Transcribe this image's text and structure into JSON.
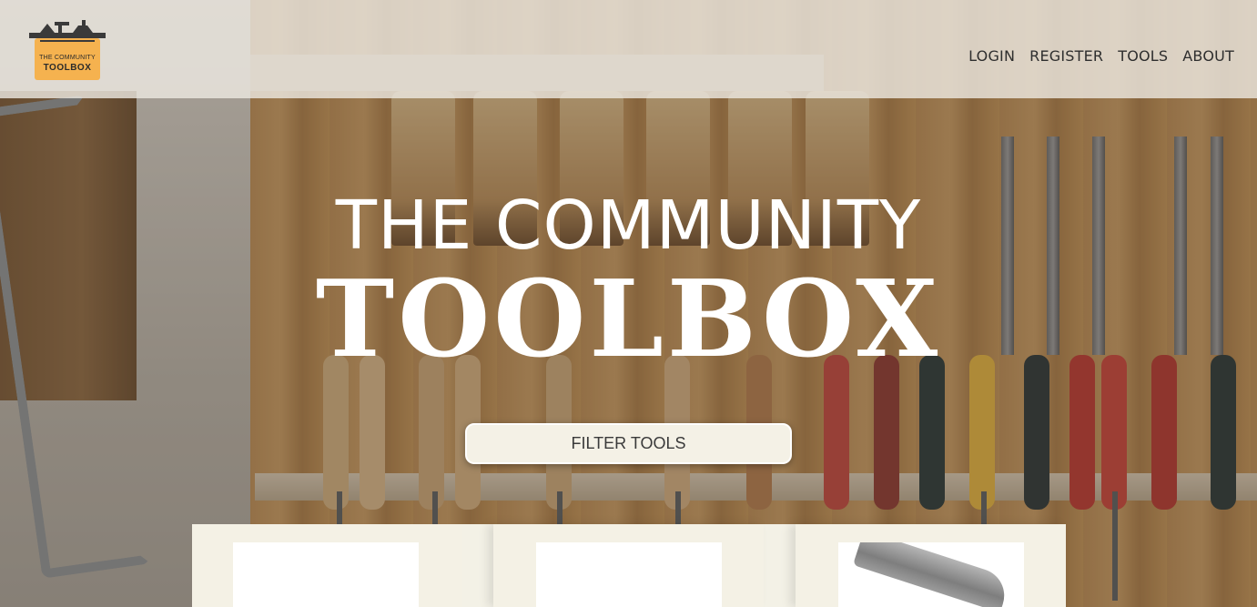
{
  "header": {
    "logo": {
      "line1": "THE COMMUNITY",
      "line2": "TOOLBOX",
      "icon": "toolbox-logo-icon"
    },
    "nav": [
      {
        "label": "LOGIN"
      },
      {
        "label": "REGISTER"
      },
      {
        "label": "TOOLS"
      },
      {
        "label": "ABOUT"
      }
    ]
  },
  "hero": {
    "line1": "THE COMMUNITY",
    "line2": "TOOLBOX"
  },
  "filter_button": {
    "label": "FILTER TOOLS"
  },
  "colors": {
    "header_bg": "#eeeae2",
    "logo_orange": "#f5b24f",
    "card_bg": "#f4f1e5",
    "button_bg": "#f4f1e6",
    "hero_text": "#ffffff"
  }
}
